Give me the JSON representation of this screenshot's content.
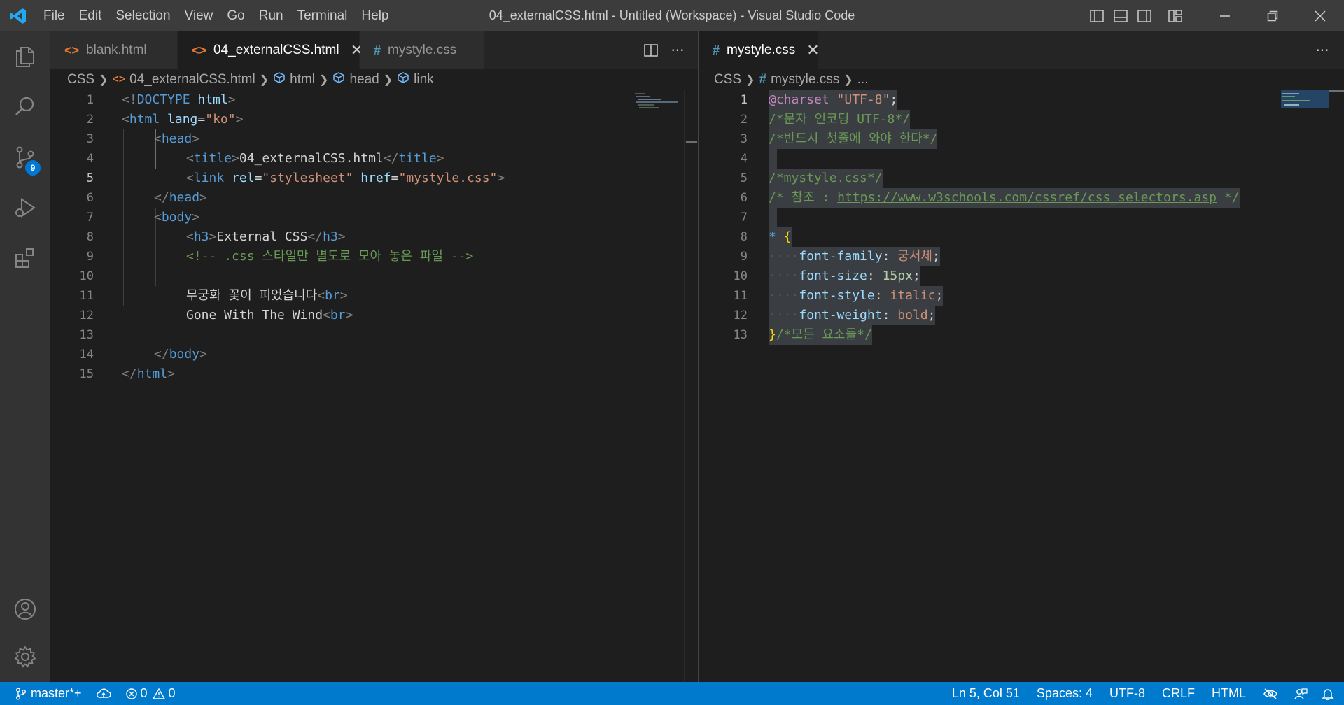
{
  "titlebar": {
    "menu": [
      "File",
      "Edit",
      "Selection",
      "View",
      "Go",
      "Run",
      "Terminal",
      "Help"
    ],
    "window_title": "04_externalCSS.html - Untitled (Workspace) - Visual Studio Code"
  },
  "activitybar": {
    "scm_badge": "9"
  },
  "group1": {
    "tabs": [
      {
        "label": "blank.html",
        "icon": "html-file-icon"
      },
      {
        "label": "04_externalCSS.html",
        "icon": "html-file-icon",
        "active": true
      },
      {
        "label": "mystyle.css",
        "icon": "css-file-icon"
      }
    ],
    "breadcrumb": [
      "CSS",
      "04_externalCSS.html",
      "html",
      "head",
      "link"
    ],
    "line_numbers": [
      "1",
      "2",
      "3",
      "4",
      "5",
      "6",
      "7",
      "8",
      "9",
      "10",
      "11",
      "12",
      "13",
      "14",
      "15"
    ],
    "lines": {
      "l1": {
        "a": "<!",
        "b": "DOCTYPE",
        "c": " html",
        "d": ">"
      },
      "l2": {
        "a": "<",
        "b": "html",
        "c": " lang",
        "d": "=",
        "e": "\"ko\"",
        "f": ">"
      },
      "l3": {
        "a": "<",
        "b": "head",
        "c": ">"
      },
      "l4": {
        "a": "<",
        "b": "title",
        "c": ">",
        "d": "04_externalCSS.html",
        "e": "</",
        "f": "title",
        "g": ">"
      },
      "l5": {
        "a": "<",
        "b": "link",
        "c": " rel",
        "d": "=",
        "e": "\"stylesheet\"",
        "f": " href",
        "g": "=",
        "h": "\"",
        "i": "mystyle.css",
        "j": "\"",
        "k": ">"
      },
      "l6": {
        "a": "</",
        "b": "head",
        "c": ">"
      },
      "l7": {
        "a": "<",
        "b": "body",
        "c": ">"
      },
      "l8": {
        "a": "<",
        "b": "h3",
        "c": ">",
        "d": "External CSS",
        "e": "</",
        "f": "h3",
        "g": ">"
      },
      "l9": {
        "a": "<!-- .css 스타일만 별도로 모아 놓은 파일 -->"
      },
      "l11": {
        "a": "무궁화 꽃이 피었습니다",
        "b": "<",
        "c": "br",
        "d": ">"
      },
      "l12": {
        "a": "Gone With The Wind",
        "b": "<",
        "c": "br",
        "d": ">"
      },
      "l14": {
        "a": "</",
        "b": "body",
        "c": ">"
      },
      "l15": {
        "a": "</",
        "b": "html",
        "c": ">"
      }
    }
  },
  "group2": {
    "tabs": [
      {
        "label": "mystyle.css",
        "icon": "css-file-icon",
        "active": true
      }
    ],
    "breadcrumb": [
      "CSS",
      "mystyle.css",
      "..."
    ],
    "line_numbers": [
      "1",
      "2",
      "3",
      "4",
      "5",
      "6",
      "7",
      "8",
      "9",
      "10",
      "11",
      "12",
      "13"
    ],
    "lines": {
      "l1": {
        "a": "@charset",
        "b": " ",
        "c": "\"UTF-8\"",
        "d": ";"
      },
      "l2": {
        "a": "/*문자 인코딩 UTF-8*/"
      },
      "l3": {
        "a": "/*반드시 첫줄에 와야 한다*/"
      },
      "l5": {
        "a": "/*mystyle.css*/"
      },
      "l6": {
        "a": "/* 참조 : ",
        "b": "https://www.w3schools.com/cssref/css_selectors.asp",
        "c": " */"
      },
      "l8": {
        "a": "*",
        "b": " ",
        "c": "{"
      },
      "l9": {
        "ws": "····",
        "a": "font-family",
        "b": ": ",
        "c": "궁서체",
        "d": ";"
      },
      "l10": {
        "ws": "····",
        "a": "font-size",
        "b": ": ",
        "c": "15px",
        "d": ";"
      },
      "l11": {
        "ws": "····",
        "a": "font-style",
        "b": ": ",
        "c": "italic",
        "d": ";"
      },
      "l12": {
        "ws": "····",
        "a": "font-weight",
        "b": ": ",
        "c": "bold",
        "d": ";"
      },
      "l13": {
        "a": "}",
        "b": "/*모든 요소들*/"
      }
    }
  },
  "statusbar": {
    "branch": "master*+",
    "errors": "0",
    "warnings": "0",
    "position": "Ln 5, Col 51",
    "spaces": "Spaces: 4",
    "encoding": "UTF-8",
    "eol": "CRLF",
    "language": "HTML"
  },
  "colors": {
    "statusbar": "#007acc",
    "titlebar": "#3c3c3c",
    "activitybar": "#333333",
    "editor": "#1e1e1e",
    "tag": "#569cd6",
    "attribute": "#9cdcfe",
    "string": "#ce9178",
    "comment": "#6a9955"
  }
}
